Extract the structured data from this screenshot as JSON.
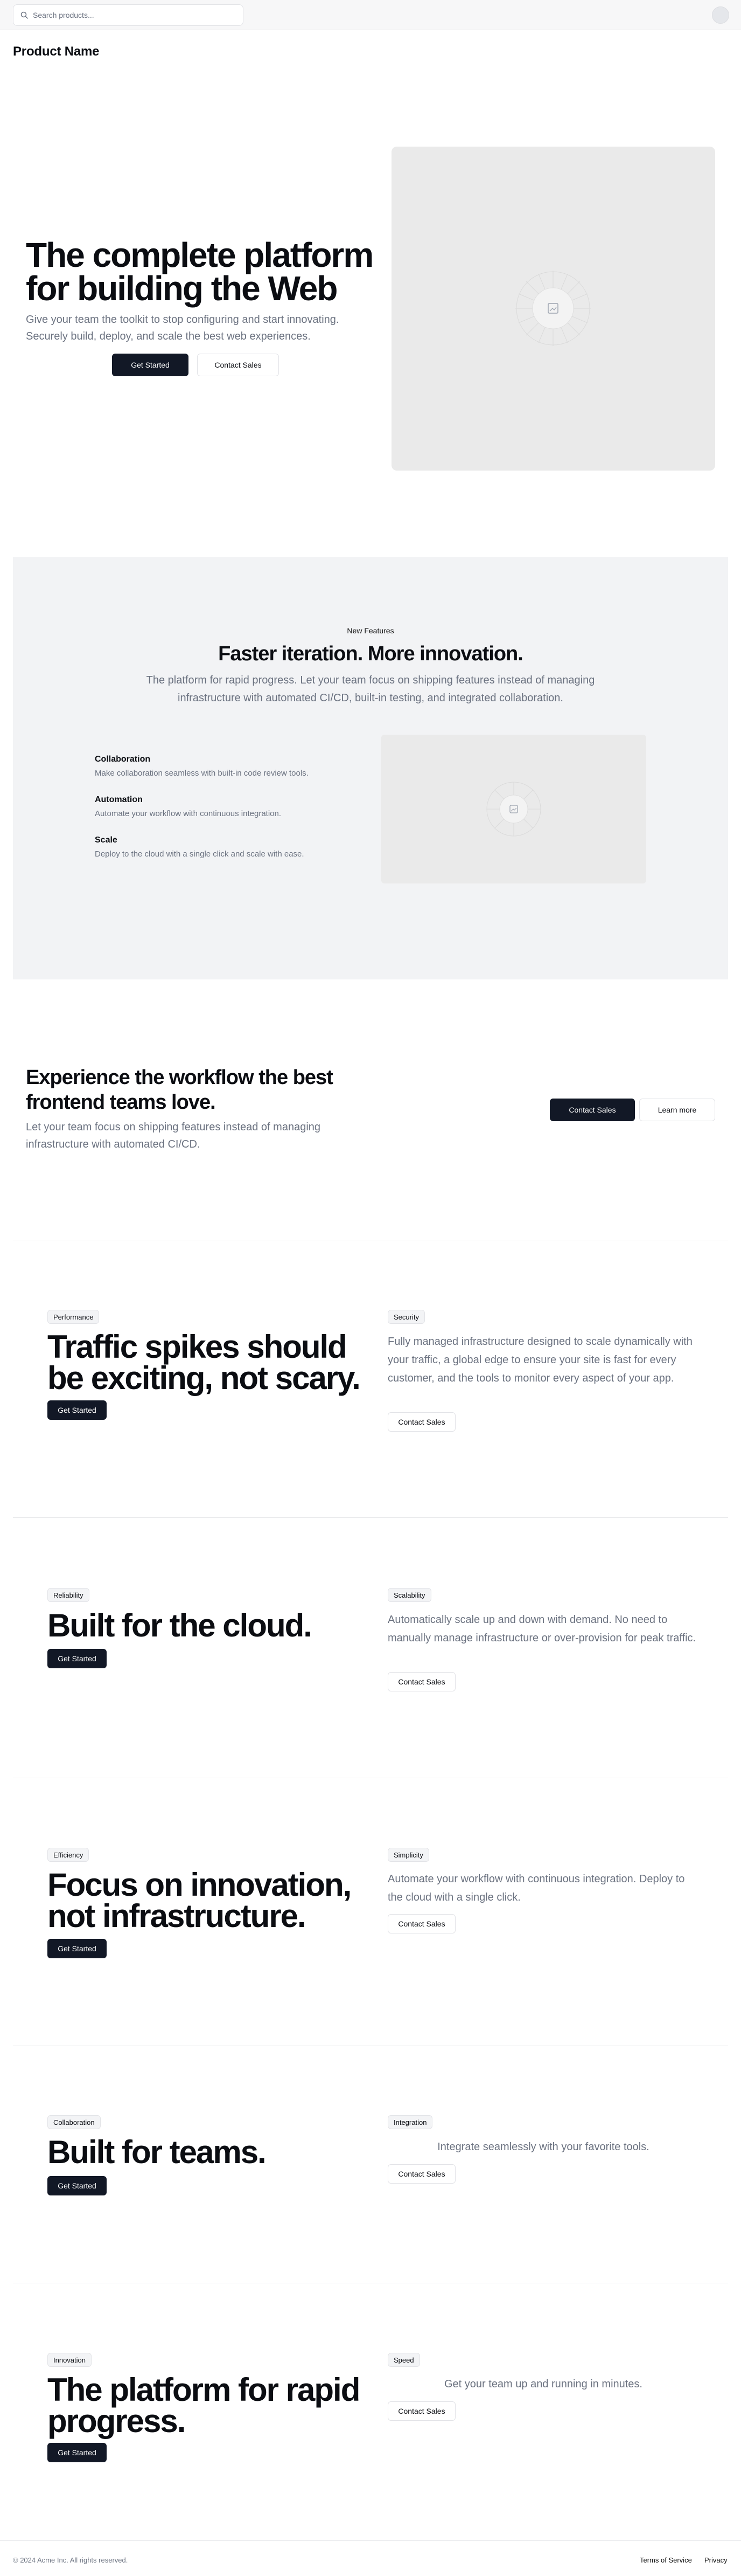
{
  "header": {
    "search_placeholder": "Search products...",
    "search_value": "",
    "product_name": "Product Name"
  },
  "hero": {
    "title": "The complete platform for building the Web",
    "subtitle": "Give your team the toolkit to stop configuring and start innovating. Securely build, deploy, and scale the best web experiences.",
    "primary_button": "Get Started",
    "secondary_button": "Contact Sales",
    "image_icon": "image-placeholder-icon"
  },
  "features": {
    "kicker": "New Features",
    "title": "Faster iteration. More innovation.",
    "subtitle": "The platform for rapid progress. Let your team focus on shipping features instead of managing infrastructure with automated CI/CD, built-in testing, and integrated collaboration.",
    "items": [
      {
        "title": "Collaboration",
        "description": "Make collaboration seamless with built-in code review tools."
      },
      {
        "title": "Automation",
        "description": "Automate your workflow with continuous integration."
      },
      {
        "title": "Scale",
        "description": "Deploy to the cloud with a single click and scale with ease."
      }
    ],
    "image_icon": "image-placeholder-icon"
  },
  "cta": {
    "title": "Experience the workflow the best frontend teams love.",
    "subtitle": "Let your team focus on shipping features instead of managing infrastructure with automated CI/CD.",
    "primary_button": "Contact Sales",
    "secondary_button": "Learn more"
  },
  "sections": [
    {
      "badge": "Performance",
      "title": "Traffic spikes should be exciting, not scary.",
      "button": "Get Started",
      "right_badge": "Security",
      "text": "Fully managed infrastructure designed to scale dynamically with your traffic, a global edge to ensure your site is fast for every customer, and the tools to monitor every aspect of your app.",
      "right_button": "Contact Sales"
    },
    {
      "badge": "Reliability",
      "title": "Built for the cloud.",
      "button": "Get Started",
      "right_badge": "Scalability",
      "text": "Automatically scale up and down with demand. No need to manually manage infrastructure or over-provision for peak traffic.",
      "right_button": "Contact Sales"
    },
    {
      "badge": "Efficiency",
      "title": "Focus on innovation, not infrastructure.",
      "button": "Get Started",
      "right_badge": "Simplicity",
      "text": "Automate your workflow with continuous integration. Deploy to the cloud with a single click.",
      "right_button": "Contact Sales"
    },
    {
      "badge": "Collaboration",
      "title": "Built for teams.",
      "button": "Get Started",
      "right_badge": "Integration",
      "text": "Integrate seamlessly with your favorite tools.",
      "right_button": "Contact Sales"
    },
    {
      "badge": "Innovation",
      "title": "The platform for rapid progress.",
      "button": "Get Started",
      "right_badge": "Speed",
      "text": "Get your team up and running in minutes.",
      "right_button": "Contact Sales"
    }
  ],
  "footer": {
    "copyright": "© 2024 Acme Inc. All rights reserved.",
    "links": [
      "Terms of Service",
      "Privacy"
    ]
  },
  "colors": {
    "primary": "#121826",
    "muted_text": "#6b7280",
    "section_bg": "#f2f3f5",
    "placeholder": "#eaeaea"
  }
}
